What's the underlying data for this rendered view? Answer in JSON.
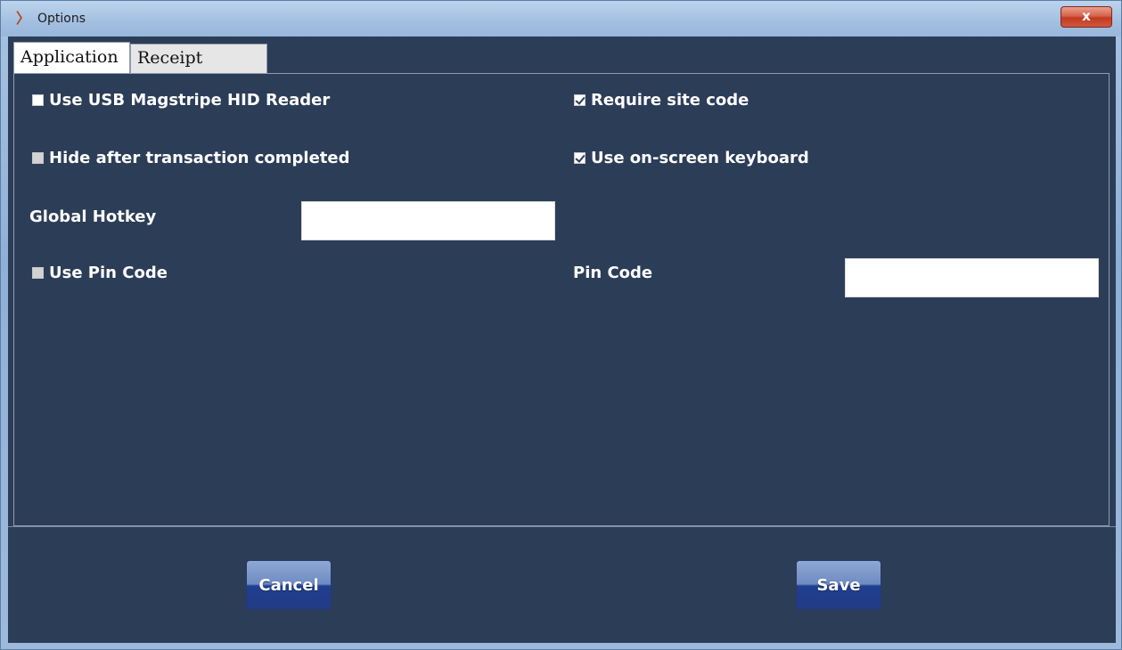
{
  "window": {
    "title": "Options",
    "close_label": "x"
  },
  "tabs": [
    {
      "label": "Application",
      "selected": true
    },
    {
      "label": "Receipt Printer",
      "selected": false
    }
  ],
  "settings": {
    "use_usb_magstripe": {
      "label": "Use USB Magstripe HID Reader",
      "checked": false
    },
    "require_site_code": {
      "label": "Require site code",
      "checked": true
    },
    "hide_after_transaction": {
      "label": "Hide after transaction completed",
      "checked": false
    },
    "use_onscreen_keyboard": {
      "label": "Use on-screen keyboard",
      "checked": true
    },
    "global_hotkey": {
      "label": "Global Hotkey",
      "value": ""
    },
    "use_pin_code": {
      "label": "Use Pin Code",
      "checked": false
    },
    "pin_code": {
      "label": "Pin Code",
      "value": ""
    }
  },
  "buttons": {
    "cancel": "Cancel",
    "save": "Save"
  },
  "colors": {
    "panel": "#2c3d58",
    "button": "#223b85",
    "text": "#ffffff"
  }
}
